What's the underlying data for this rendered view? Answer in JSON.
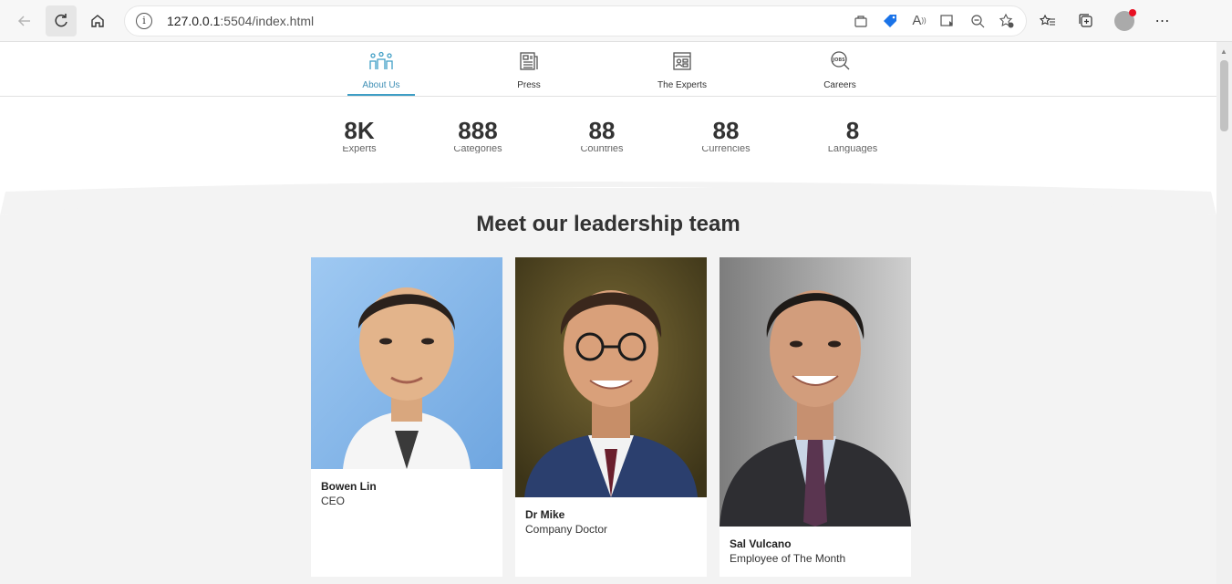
{
  "browser": {
    "url_host": "127.0.0.1",
    "url_rest": ":5504/index.html"
  },
  "nav": {
    "items": [
      {
        "label": "About Us",
        "icon": "people-icon",
        "active": true
      },
      {
        "label": "Press",
        "icon": "newspaper-icon",
        "active": false
      },
      {
        "label": "The Experts",
        "icon": "expert-board-icon",
        "active": false
      },
      {
        "label": "Careers",
        "icon": "jobs-search-icon",
        "active": false
      }
    ]
  },
  "stats": [
    {
      "value": "8K",
      "label": "Experts"
    },
    {
      "value": "888",
      "label": "Categories"
    },
    {
      "value": "88",
      "label": "Countries"
    },
    {
      "value": "88",
      "label": "Currencies"
    },
    {
      "value": "8",
      "label": "Languages"
    }
  ],
  "section": {
    "title": "Meet our leadership team"
  },
  "team": [
    {
      "name": "Bowen Lin",
      "role": "CEO"
    },
    {
      "name": "Dr Mike",
      "role": "Company Doctor"
    },
    {
      "name": "Sal Vulcano",
      "role": "Employee of The Month"
    }
  ],
  "colors": {
    "accent": "#3f9ec5",
    "text": "#333333",
    "background": "#f3f3f3"
  }
}
